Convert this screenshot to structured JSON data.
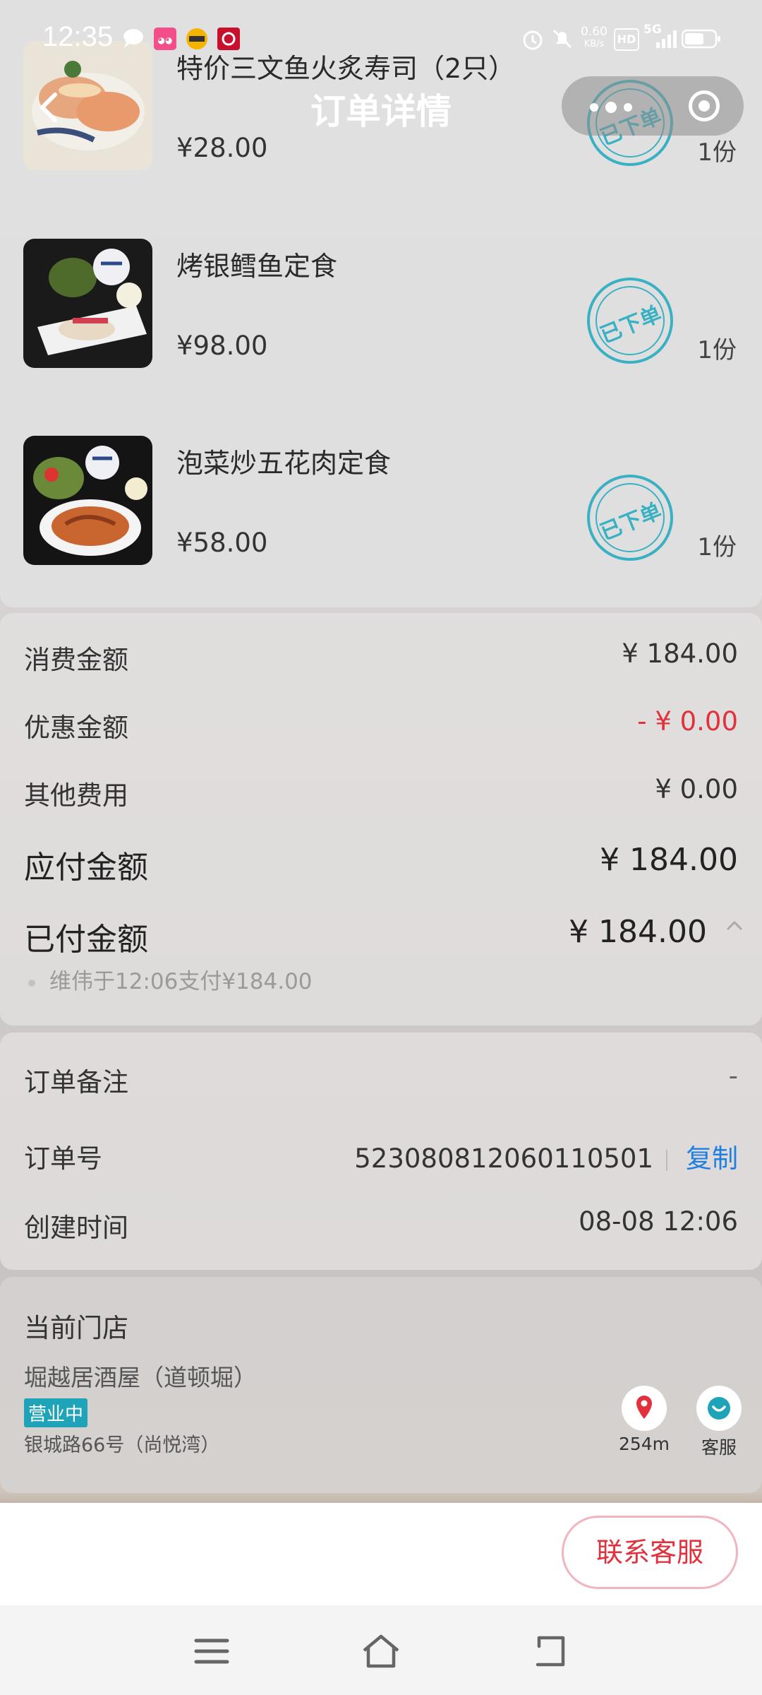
{
  "status_bar": {
    "time": "12:35",
    "net_speed": "0.60",
    "net_unit": "KB/s",
    "hd_label": "HD",
    "network": "5G"
  },
  "nav": {
    "title": "订单详情"
  },
  "items": [
    {
      "name": "特价三文鱼火炙寿司（2只）",
      "price": "¥28.00",
      "qty": "1份",
      "stamp": "已下单"
    },
    {
      "name": "烤银鳕鱼定食",
      "price": "¥98.00",
      "qty": "1份",
      "stamp": "已下单"
    },
    {
      "name": "泡菜炒五花肉定食",
      "price": "¥58.00",
      "qty": "1份",
      "stamp": "已下单"
    }
  ],
  "amounts": {
    "consume_label": "消费金额",
    "consume_value": "¥ 184.00",
    "discount_label": "优惠金额",
    "discount_value": "- ¥ 0.00",
    "other_label": "其他费用",
    "other_value": "¥ 0.00",
    "payable_label": "应付金额",
    "payable_value": "¥ 184.00",
    "paid_label": "已付金额",
    "paid_value": "¥ 184.00",
    "pay_note": "维伟于12:06支付¥184.00"
  },
  "info": {
    "remark_label": "订单备注",
    "remark_value": "-",
    "order_no_label": "订单号",
    "order_no_value": "523080812060110501",
    "copy_label": "复制",
    "created_label": "创建时间",
    "created_value": "08-08 12:06"
  },
  "store": {
    "heading": "当前门店",
    "name": "堀越居酒屋（道顿堀）",
    "status": "营业中",
    "address": "银城路66号（尚悦湾）",
    "distance": "254m",
    "service_label": "客服"
  },
  "bottom": {
    "contact_label": "联系客服"
  },
  "colors": {
    "accent_red": "#e2313c",
    "link_blue": "#1f7fe0",
    "stamp_teal": "#3ab1c2",
    "status_teal": "#1fa3b8"
  }
}
